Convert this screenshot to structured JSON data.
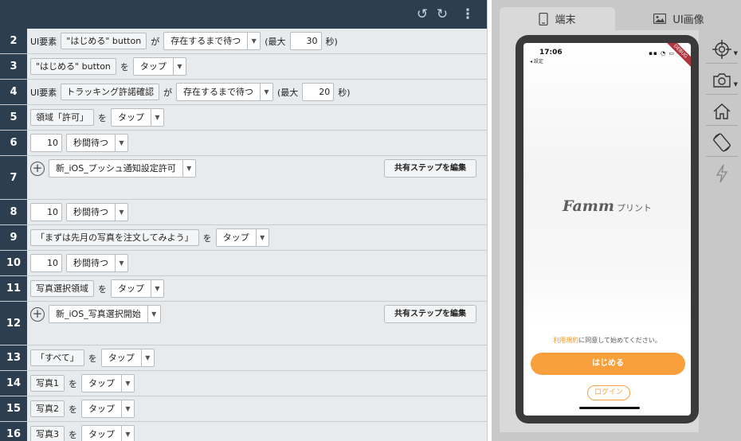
{
  "editor": {
    "steps": [
      {
        "num": "2",
        "kind": "wait",
        "prefix": "UI要素",
        "element": "\"はじめる\" button",
        "particle": "が",
        "condition": "存在するまで待つ",
        "max_label": "(最大",
        "max_value": "30",
        "unit": "秒)"
      },
      {
        "num": "3",
        "kind": "action",
        "element": "\"はじめる\" button",
        "particle": "を",
        "action": "タップ"
      },
      {
        "num": "4",
        "kind": "wait",
        "prefix": "UI要素",
        "element": "トラッキング許諾確認",
        "particle": "が",
        "condition": "存在するまで待つ",
        "max_label": "(最大",
        "max_value": "20",
        "unit": "秒)"
      },
      {
        "num": "5",
        "kind": "action",
        "element": "領域「許可」",
        "particle": "を",
        "action": "タップ"
      },
      {
        "num": "6",
        "kind": "sleep",
        "value": "10",
        "action": "秒間待つ"
      },
      {
        "num": "7",
        "kind": "shared",
        "step_name": "新_iOS_プッシュ通知設定許可",
        "edit_label": "共有ステップを編集"
      },
      {
        "num": "8",
        "kind": "sleep",
        "value": "10",
        "action": "秒間待つ"
      },
      {
        "num": "9",
        "kind": "action",
        "element": "「まずは先月の写真を注文してみよう」",
        "particle": "を",
        "action": "タップ"
      },
      {
        "num": "10",
        "kind": "sleep",
        "value": "10",
        "action": "秒間待つ"
      },
      {
        "num": "11",
        "kind": "action",
        "element": "写真選択領域",
        "particle": "を",
        "action": "タップ"
      },
      {
        "num": "12",
        "kind": "shared",
        "step_name": "新_iOS_写真選択開始",
        "edit_label": "共有ステップを編集"
      },
      {
        "num": "13",
        "kind": "action",
        "element": "「すべて」",
        "particle": "を",
        "action": "タップ"
      },
      {
        "num": "14",
        "kind": "action",
        "element": "写真1",
        "particle": "を",
        "action": "タップ"
      },
      {
        "num": "15",
        "kind": "action",
        "element": "写真2",
        "particle": "を",
        "action": "タップ"
      },
      {
        "num": "16",
        "kind": "action",
        "element": "写真3",
        "particle": "を",
        "action": "タップ"
      }
    ]
  },
  "toolbar": {
    "icons": [
      "undo-icon",
      "redo-icon",
      "more-vertical-icon"
    ]
  },
  "device_panel": {
    "tabs": [
      {
        "label": "端末",
        "icon": "phone-icon",
        "active": true
      },
      {
        "label": "UI画像",
        "icon": "image-icon",
        "active": false
      }
    ],
    "tools": [
      "crosshair-icon",
      "camera-icon",
      "home-icon",
      "rotate-icon",
      "lightning-icon"
    ],
    "phone": {
      "time": "17:06",
      "back_label": "◂ 設定",
      "ribbon": "DEBUG",
      "logo_main": "Famm",
      "logo_sub": "プリント",
      "terms_link": "利用規約",
      "terms_rest": "に同意して始めてください。",
      "start_label": "はじめる",
      "login_label": "ログイン"
    }
  },
  "colors": {
    "header_bg": "#2c3e50",
    "accent_orange": "#f8a03b",
    "panel_bg": "#c8c8c8"
  }
}
